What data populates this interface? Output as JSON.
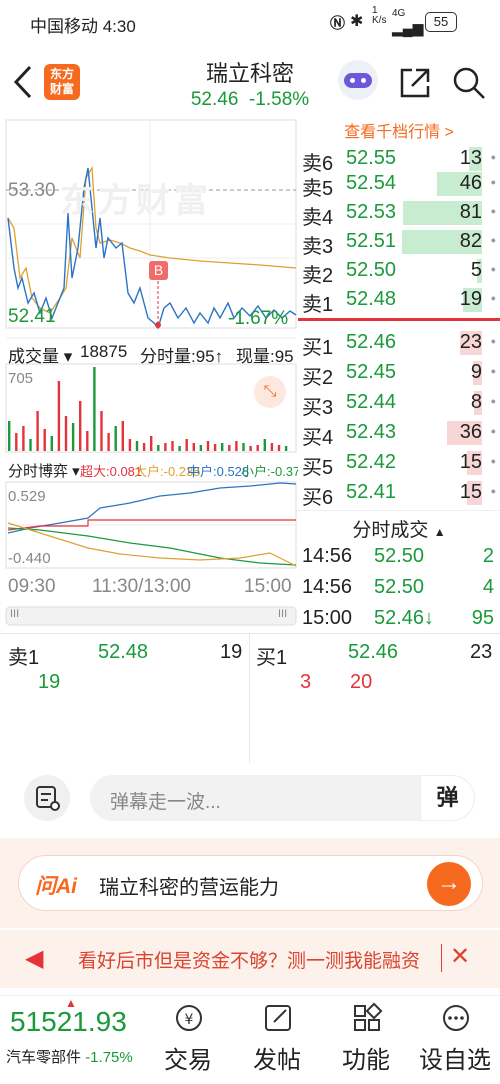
{
  "status_bar": {
    "carrier_time": "中国移动 4:30",
    "net_speed_top": "1",
    "net_speed_unit": "K/s",
    "signal": "4G",
    "battery": "55"
  },
  "header": {
    "stock_name": "瑞立科密",
    "price": "52.46",
    "change_pct": "-1.58%",
    "logo_line1": "东方",
    "logo_line2": "财富"
  },
  "chart": {
    "price_high": "53.30",
    "price_low": "52.41",
    "pct_low": "-1.67%",
    "buy_marker": "B",
    "watermark": "东方财富",
    "volume_label": "成交量",
    "volume_value": "18875",
    "tick_volume": "分时量:95↑",
    "current_volume": "现量:95",
    "volume_max": "705",
    "game_label": "分时博弈",
    "game_super": "超大:0.081",
    "game_big": "大户:-0.235",
    "game_mid": "中户:0.528",
    "game_small": "小户:-0.374",
    "game_top": "0.529",
    "game_bottom": "-0.440",
    "time_start": "09:30",
    "time_mid": "11:30/13:00",
    "time_end": "15:00",
    "scroll_left": "III",
    "scroll_right": "III"
  },
  "orderbook": {
    "link": "查看千档行情 >",
    "sells": [
      {
        "label": "卖6",
        "price": "52.55",
        "vol": "13"
      },
      {
        "label": "卖5",
        "price": "52.54",
        "vol": "46"
      },
      {
        "label": "卖4",
        "price": "52.53",
        "vol": "81"
      },
      {
        "label": "卖3",
        "price": "52.51",
        "vol": "82"
      },
      {
        "label": "卖2",
        "price": "52.50",
        "vol": "5"
      },
      {
        "label": "卖1",
        "price": "52.48",
        "vol": "19"
      }
    ],
    "buys": [
      {
        "label": "买1",
        "price": "52.46",
        "vol": "23"
      },
      {
        "label": "买2",
        "price": "52.45",
        "vol": "9"
      },
      {
        "label": "买3",
        "price": "52.44",
        "vol": "8"
      },
      {
        "label": "买4",
        "price": "52.43",
        "vol": "36"
      },
      {
        "label": "买5",
        "price": "52.42",
        "vol": "15"
      },
      {
        "label": "买6",
        "price": "52.41",
        "vol": "15"
      }
    ],
    "ticks_title": "分时成交",
    "ticks": [
      {
        "time": "14:56",
        "price": "52.50",
        "vol": "2"
      },
      {
        "time": "14:56",
        "price": "52.50",
        "vol": "4"
      },
      {
        "time": "15:00",
        "price": "52.46↓",
        "vol": "95"
      }
    ]
  },
  "queue": {
    "sell_label": "卖1",
    "sell_price": "52.48",
    "sell_vol": "19",
    "sell_q1": "19",
    "buy_label": "买1",
    "buy_price": "52.46",
    "buy_vol": "23",
    "buy_q1": "3",
    "buy_q2": "20"
  },
  "danmu": {
    "placeholder": "弹幕走一波...",
    "send_label": "弹"
  },
  "ai": {
    "brand": "问Ai",
    "text": "瑞立科密的营运能力"
  },
  "ad": {
    "text": "看好后市但是资金不够？测一测我能融资"
  },
  "tabbar": {
    "index_value": "51521.93",
    "index_name": "汽车零部件",
    "index_change": "-1.75%",
    "tabs": [
      {
        "label": "交易",
        "icon": "trade-icon"
      },
      {
        "label": "发帖",
        "icon": "post-icon"
      },
      {
        "label": "功能",
        "icon": "function-icon"
      },
      {
        "label": "设自选",
        "icon": "add-favorite-icon"
      }
    ]
  },
  "colors": {
    "up": "#e5323b",
    "down": "#1a9a3a",
    "accent": "#f56a1f"
  }
}
